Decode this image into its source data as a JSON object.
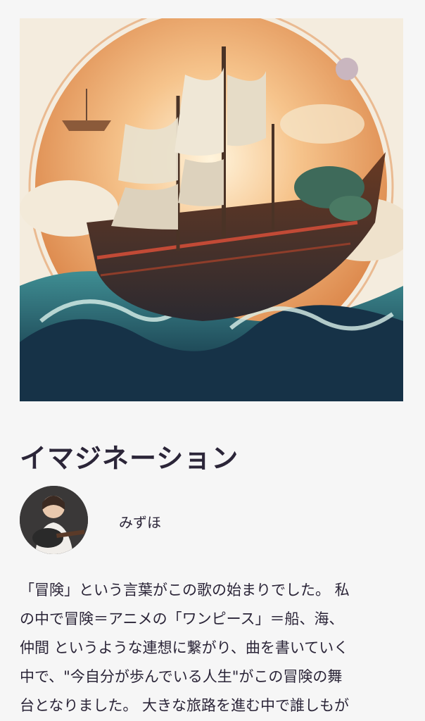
{
  "post": {
    "title": "イマジネーション",
    "author": {
      "name": "みずほ"
    },
    "body_lines": [
      "「冒険」という言葉がこの歌の始まりでした。 私",
      "の中で冒険＝アニメの「ワンピース」＝船、海、",
      "仲間 というような連想に繋がり、曲を書いていく",
      "中で、\"今自分が歩んでいる人生\"がこの冒険の舞",
      "台となりました。 大きな旅路を進む中で誰しもが"
    ]
  },
  "colors": {
    "background": "#f6f6f6",
    "text": "#2b2538"
  }
}
